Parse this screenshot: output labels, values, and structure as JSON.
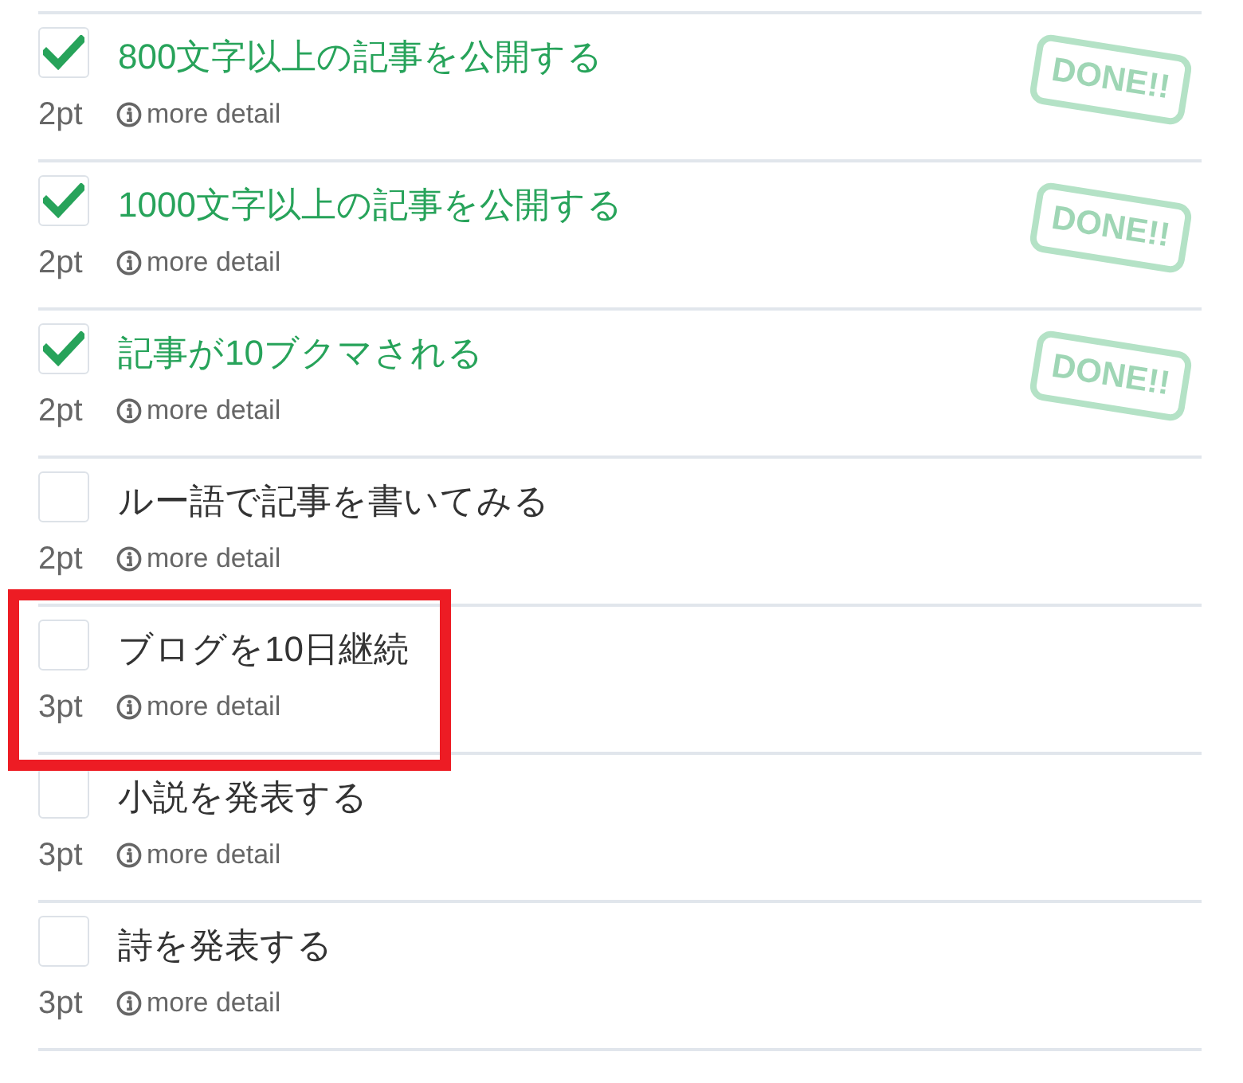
{
  "items": [
    {
      "checked": true,
      "title": "800文字以上の記事を公開する",
      "points": "2pt",
      "link": "more detail",
      "stamp": "DONE!!",
      "highlighted": false
    },
    {
      "checked": true,
      "title": "1000文字以上の記事を公開する",
      "points": "2pt",
      "link": "more detail",
      "stamp": "DONE!!",
      "highlighted": false
    },
    {
      "checked": true,
      "title": "記事が10ブクマされる",
      "points": "2pt",
      "link": "more detail",
      "stamp": "DONE!!",
      "highlighted": false
    },
    {
      "checked": false,
      "title": "ルー語で記事を書いてみる",
      "points": "2pt",
      "link": "more detail",
      "highlighted": false
    },
    {
      "checked": false,
      "title": "ブログを10日継続",
      "points": "3pt",
      "link": "more detail",
      "highlighted": true
    },
    {
      "checked": false,
      "title": "小説を発表する",
      "points": "3pt",
      "link": "more detail",
      "highlighted": false
    },
    {
      "checked": false,
      "title": "詩を発表する",
      "points": "3pt",
      "link": "more detail",
      "highlighted": false
    }
  ]
}
